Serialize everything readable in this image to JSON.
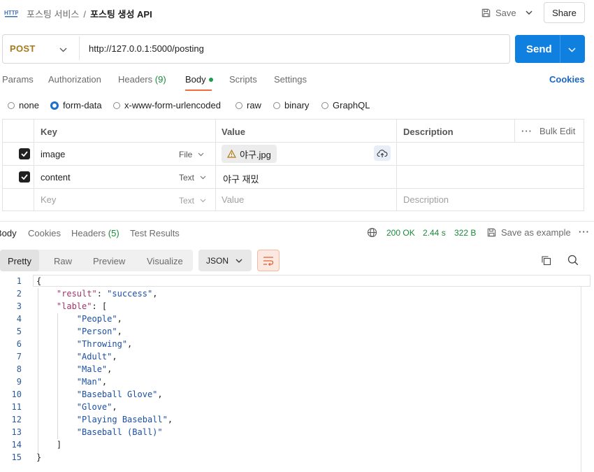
{
  "header": {
    "http_badge": "HTTP",
    "breadcrumb_parent": "포스팅 서비스",
    "breadcrumb_sep": "/",
    "breadcrumb_current": "포스팅 생성 API",
    "save_label": "Save",
    "share_label": "Share"
  },
  "request": {
    "method": "POST",
    "url": "http://127.0.0.1:5000/posting",
    "send_label": "Send"
  },
  "tabs": [
    {
      "label": "Params"
    },
    {
      "label": "Authorization"
    },
    {
      "label": "Headers",
      "count": "(9)"
    },
    {
      "label": "Body",
      "active": true
    },
    {
      "label": "Scripts"
    },
    {
      "label": "Settings"
    }
  ],
  "cookies_label": "Cookies",
  "body_types": [
    "none",
    "form-data",
    "x-www-form-urlencoded",
    "raw",
    "binary",
    "GraphQL"
  ],
  "selected_body_type": "form-data",
  "form_table": {
    "headers": {
      "key": "Key",
      "value": "Value",
      "description": "Description",
      "bulk_edit": "Bulk Edit"
    },
    "rows": [
      {
        "checked": true,
        "key": "image",
        "type": "File",
        "value": "야구.jpg",
        "description": ""
      },
      {
        "checked": true,
        "key": "content",
        "type": "Text",
        "value": "야구 재밌",
        "description": ""
      }
    ],
    "placeholder_row": {
      "key": "Key",
      "type": "Text",
      "value": "Value",
      "description": "Description"
    }
  },
  "response": {
    "tabs": [
      {
        "label": "Body"
      },
      {
        "label": "Cookies"
      },
      {
        "label": "Headers",
        "count": "(5)"
      },
      {
        "label": "Test Results"
      }
    ],
    "status": "200 OK",
    "time": "2.44 s",
    "size": "322 B",
    "save_example_label": "Save as example",
    "view_modes": [
      "Pretty",
      "Raw",
      "Preview",
      "Visualize"
    ],
    "format": "JSON",
    "lines": [
      {
        "n": "1",
        "text": "{"
      },
      {
        "n": "2",
        "text": "    \"result\": \"success\","
      },
      {
        "n": "3",
        "text": "    \"lable\": ["
      },
      {
        "n": "4",
        "text": "        \"People\","
      },
      {
        "n": "5",
        "text": "        \"Person\","
      },
      {
        "n": "6",
        "text": "        \"Throwing\","
      },
      {
        "n": "7",
        "text": "        \"Adult\","
      },
      {
        "n": "8",
        "text": "        \"Male\","
      },
      {
        "n": "9",
        "text": "        \"Man\","
      },
      {
        "n": "10",
        "text": "        \"Baseball Glove\","
      },
      {
        "n": "11",
        "text": "        \"Glove\","
      },
      {
        "n": "12",
        "text": "        \"Playing Baseball\","
      },
      {
        "n": "13",
        "text": "        \"Baseball (Ball)\""
      },
      {
        "n": "14",
        "text": "    ]"
      },
      {
        "n": "15",
        "text": "}"
      }
    ]
  },
  "colors": {
    "accent": "#f26b3a",
    "send": "#0f7fe0",
    "method": "#a8791b",
    "status_ok": "#1a8a3a",
    "link": "#1a66c2"
  }
}
